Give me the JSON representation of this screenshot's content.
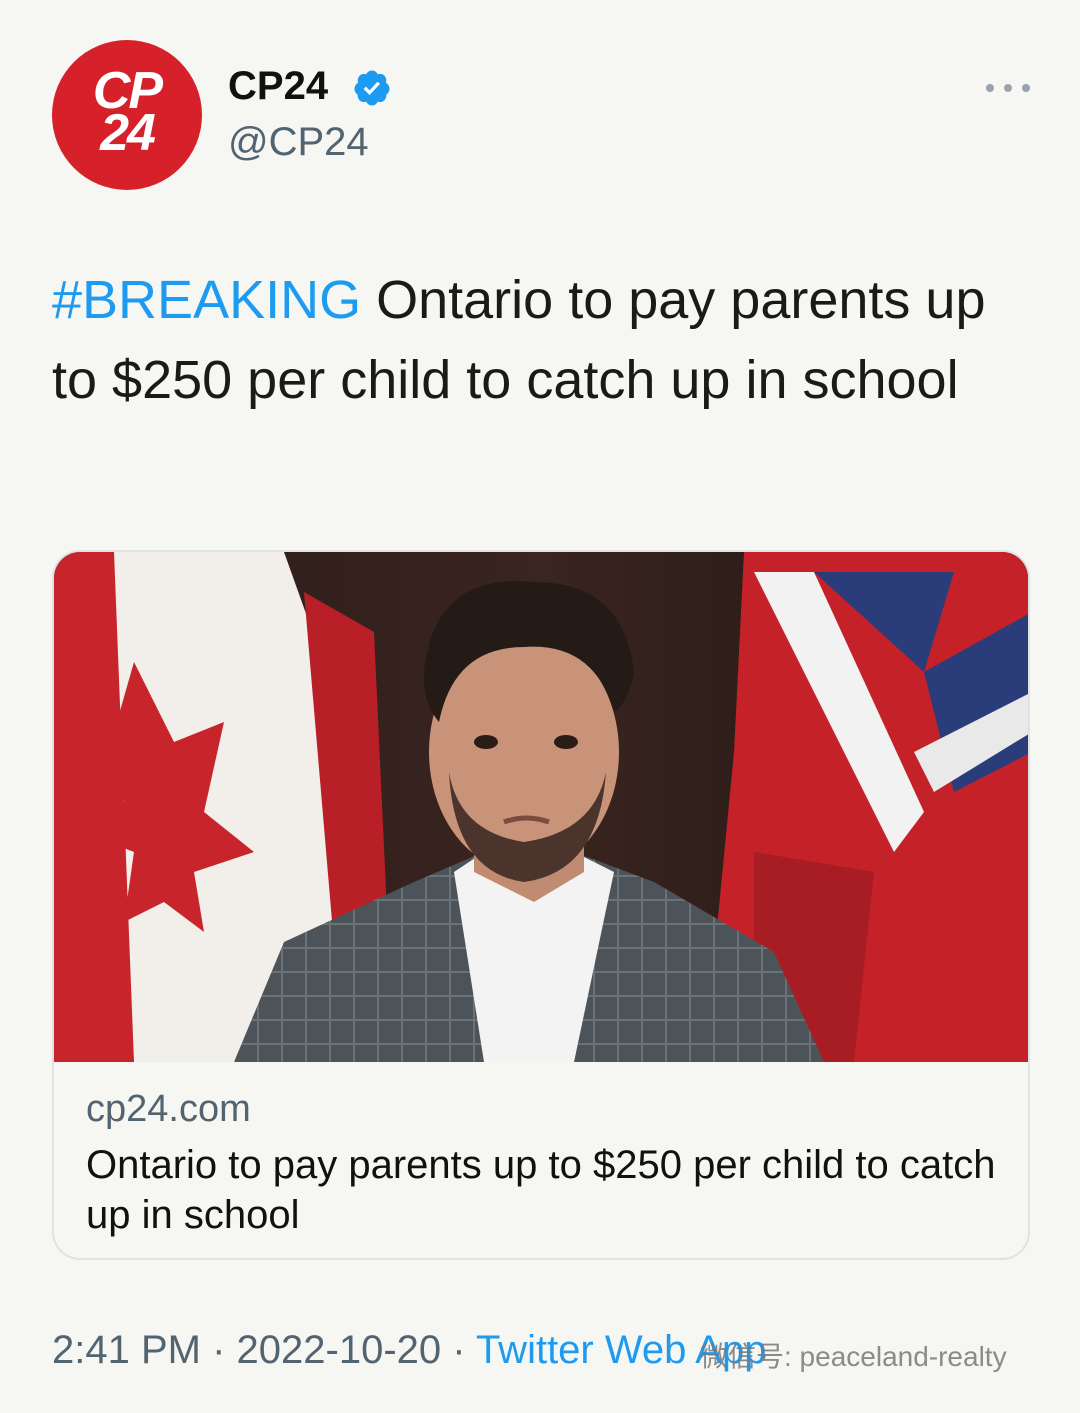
{
  "author": {
    "display_name": "CP24",
    "handle": "@CP24",
    "avatar_logo_lines": [
      "CP",
      "24"
    ],
    "avatar_color": "#d6212b",
    "verified_icon": "verified-badge-icon"
  },
  "menu": {
    "icon": "more-options-icon"
  },
  "tweet": {
    "hashtag": "#BREAKING",
    "text": " Ontario to pay parents up to $250 per child to catch up in school"
  },
  "card": {
    "domain": "cp24.com",
    "title": "Ontario to pay parents up to $250 per child to catch up in school"
  },
  "meta": {
    "time": "2:41 PM",
    "sep1": " · ",
    "date": "2022-10-20",
    "sep2": " · ",
    "app": "Twitter Web App"
  },
  "watermark": {
    "text": "微信号: peaceland-realty"
  },
  "colors": {
    "link": "#1d9bf0",
    "secondary": "#536471",
    "background": "#f6f6f3"
  }
}
